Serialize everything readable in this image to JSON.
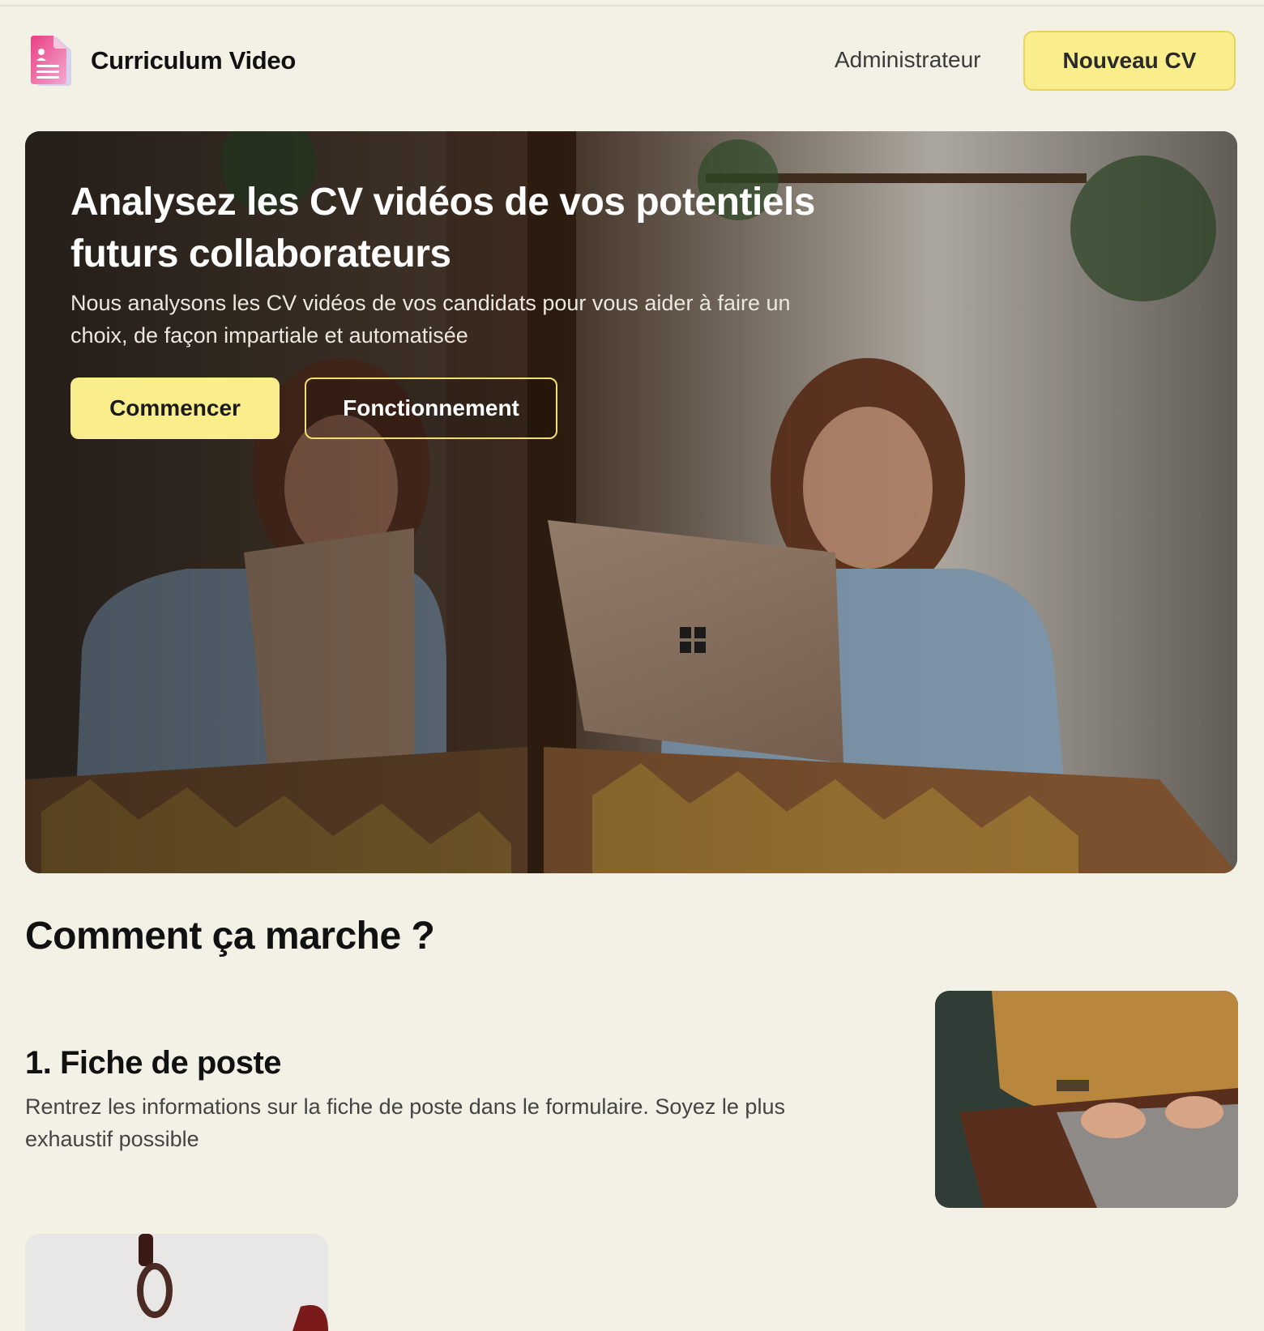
{
  "header": {
    "brand_name": "Curriculum Video",
    "logo_icon": "document-person-icon",
    "admin_label": "Administrateur",
    "new_cv_label": "Nouveau CV"
  },
  "hero": {
    "title": "Analysez les CV vidéos de vos potentiels futurs collaborateurs",
    "subtitle": "Nous analysons les CV vidéos de vos candidats pour vous aider à faire un choix, de façon impartiale et automatisée",
    "start_label": "Commencer",
    "how_label": "Fonctionnement"
  },
  "how_it_works": {
    "title": "Comment ça marche ?",
    "steps": [
      {
        "title": "1. Fiche de poste",
        "text": "Rentrez les informations sur la fiche de poste dans le formulaire. Soyez le plus exhaustif possible"
      }
    ]
  },
  "colors": {
    "background": "#f3f1e5",
    "accent_yellow": "#f9ed8c",
    "logo_pink": "#e0408a"
  }
}
